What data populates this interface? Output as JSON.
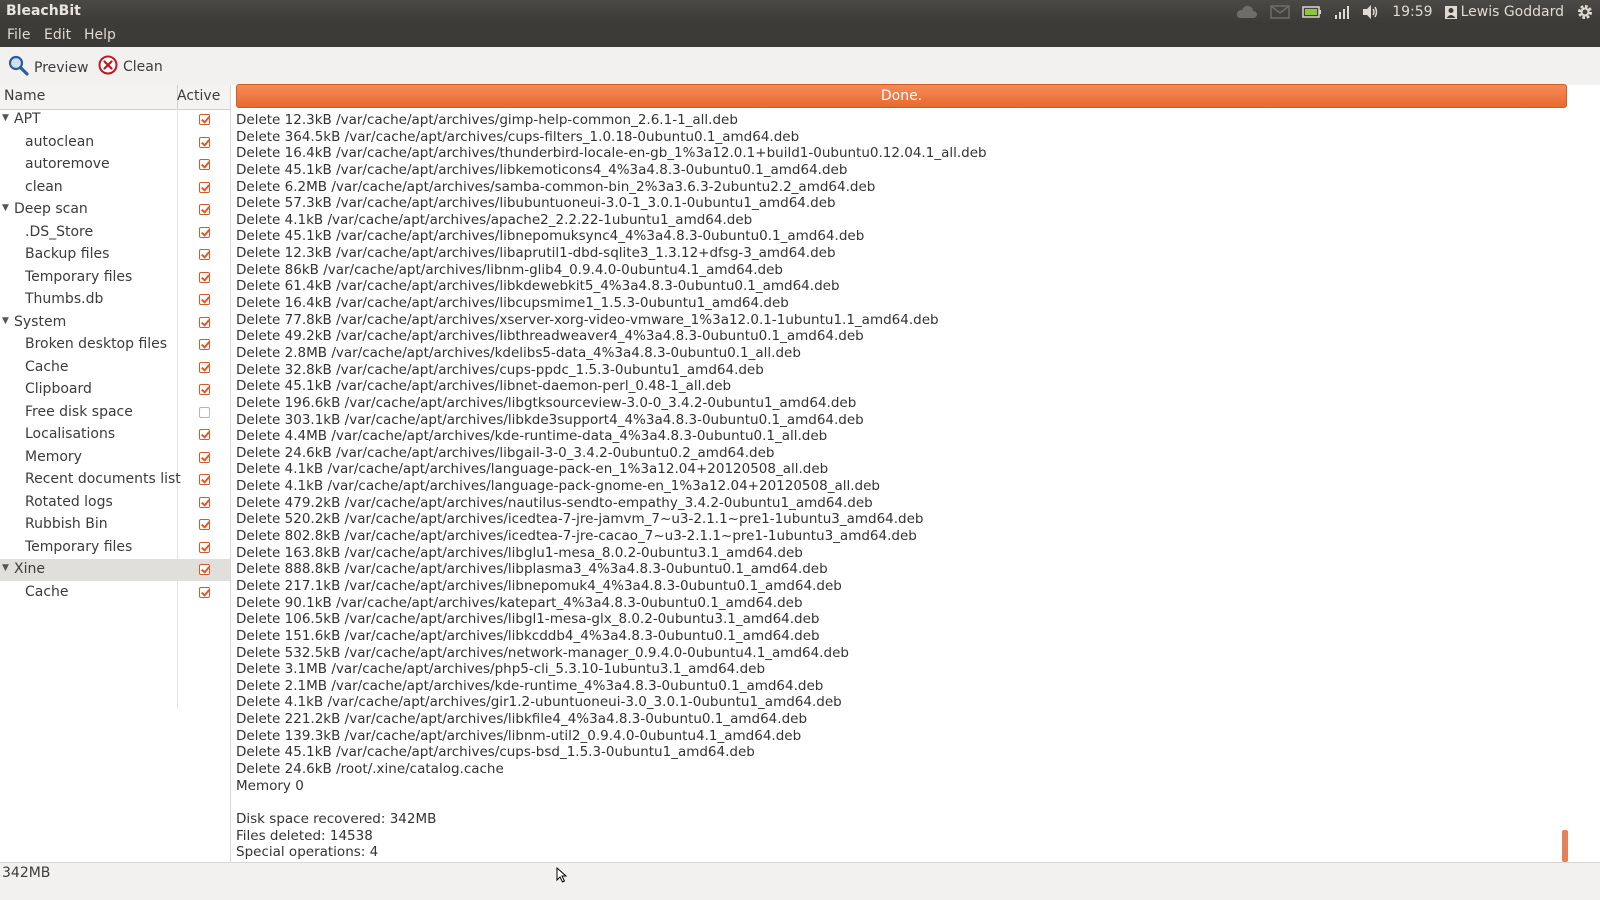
{
  "window": {
    "title": "BleachBit"
  },
  "panel": {
    "time": "19:59",
    "user": "Lewis Goddard",
    "icons": [
      "cloud-icon",
      "mail-icon",
      "battery-icon",
      "network-icon",
      "volume-icon",
      "user-icon",
      "gear-icon"
    ]
  },
  "menu": {
    "file": "File",
    "edit": "Edit",
    "help": "Help"
  },
  "toolbar": {
    "preview_label": "Preview",
    "clean_label": "Clean"
  },
  "tree": {
    "header_name": "Name",
    "header_active": "Active",
    "rows": [
      {
        "label": "APT",
        "level": 0,
        "checked": true
      },
      {
        "label": "autoclean",
        "level": 1,
        "checked": true
      },
      {
        "label": "autoremove",
        "level": 1,
        "checked": true
      },
      {
        "label": "clean",
        "level": 1,
        "checked": true
      },
      {
        "label": "Deep scan",
        "level": 0,
        "checked": true
      },
      {
        "label": ".DS_Store",
        "level": 1,
        "checked": true
      },
      {
        "label": "Backup files",
        "level": 1,
        "checked": true
      },
      {
        "label": "Temporary files",
        "level": 1,
        "checked": true
      },
      {
        "label": "Thumbs.db",
        "level": 1,
        "checked": true
      },
      {
        "label": "System",
        "level": 0,
        "checked": true
      },
      {
        "label": "Broken desktop files",
        "level": 1,
        "checked": true
      },
      {
        "label": "Cache",
        "level": 1,
        "checked": true
      },
      {
        "label": "Clipboard",
        "level": 1,
        "checked": true
      },
      {
        "label": "Free disk space",
        "level": 1,
        "checked": false
      },
      {
        "label": "Localisations",
        "level": 1,
        "checked": true
      },
      {
        "label": "Memory",
        "level": 1,
        "checked": true
      },
      {
        "label": "Recent documents list",
        "level": 1,
        "checked": true
      },
      {
        "label": "Rotated logs",
        "level": 1,
        "checked": true
      },
      {
        "label": "Rubbish Bin",
        "level": 1,
        "checked": true
      },
      {
        "label": "Temporary files",
        "level": 1,
        "checked": true
      },
      {
        "label": "Xine",
        "level": 0,
        "checked": true,
        "selected": true
      },
      {
        "label": "Cache",
        "level": 1,
        "checked": true
      }
    ]
  },
  "progress": {
    "text": "Done."
  },
  "log": {
    "lines": [
      "Delete 12.3kB /var/cache/apt/archives/gimp-help-common_2.6.1-1_all.deb",
      "Delete 364.5kB /var/cache/apt/archives/cups-filters_1.0.18-0ubuntu0.1_amd64.deb",
      "Delete 16.4kB /var/cache/apt/archives/thunderbird-locale-en-gb_1%3a12.0.1+build1-0ubuntu0.12.04.1_all.deb",
      "Delete 45.1kB /var/cache/apt/archives/libkemoticons4_4%3a4.8.3-0ubuntu0.1_amd64.deb",
      "Delete 6.2MB /var/cache/apt/archives/samba-common-bin_2%3a3.6.3-2ubuntu2.2_amd64.deb",
      "Delete 57.3kB /var/cache/apt/archives/libubuntuoneui-3.0-1_3.0.1-0ubuntu1_amd64.deb",
      "Delete 4.1kB /var/cache/apt/archives/apache2_2.2.22-1ubuntu1_amd64.deb",
      "Delete 45.1kB /var/cache/apt/archives/libnepomuksync4_4%3a4.8.3-0ubuntu0.1_amd64.deb",
      "Delete 12.3kB /var/cache/apt/archives/libaprutil1-dbd-sqlite3_1.3.12+dfsg-3_amd64.deb",
      "Delete 86kB /var/cache/apt/archives/libnm-glib4_0.9.4.0-0ubuntu4.1_amd64.deb",
      "Delete 61.4kB /var/cache/apt/archives/libkdewebkit5_4%3a4.8.3-0ubuntu0.1_amd64.deb",
      "Delete 16.4kB /var/cache/apt/archives/libcupsmime1_1.5.3-0ubuntu1_amd64.deb",
      "Delete 77.8kB /var/cache/apt/archives/xserver-xorg-video-vmware_1%3a12.0.1-1ubuntu1.1_amd64.deb",
      "Delete 49.2kB /var/cache/apt/archives/libthreadweaver4_4%3a4.8.3-0ubuntu0.1_amd64.deb",
      "Delete 2.8MB /var/cache/apt/archives/kdelibs5-data_4%3a4.8.3-0ubuntu0.1_all.deb",
      "Delete 32.8kB /var/cache/apt/archives/cups-ppdc_1.5.3-0ubuntu1_amd64.deb",
      "Delete 45.1kB /var/cache/apt/archives/libnet-daemon-perl_0.48-1_all.deb",
      "Delete 196.6kB /var/cache/apt/archives/libgtksourceview-3.0-0_3.4.2-0ubuntu1_amd64.deb",
      "Delete 303.1kB /var/cache/apt/archives/libkde3support4_4%3a4.8.3-0ubuntu0.1_amd64.deb",
      "Delete 4.4MB /var/cache/apt/archives/kde-runtime-data_4%3a4.8.3-0ubuntu0.1_all.deb",
      "Delete 24.6kB /var/cache/apt/archives/libgail-3-0_3.4.2-0ubuntu0.2_amd64.deb",
      "Delete 4.1kB /var/cache/apt/archives/language-pack-en_1%3a12.04+20120508_all.deb",
      "Delete 4.1kB /var/cache/apt/archives/language-pack-gnome-en_1%3a12.04+20120508_all.deb",
      "Delete 479.2kB /var/cache/apt/archives/nautilus-sendto-empathy_3.4.2-0ubuntu1_amd64.deb",
      "Delete 520.2kB /var/cache/apt/archives/icedtea-7-jre-jamvm_7~u3-2.1.1~pre1-1ubuntu3_amd64.deb",
      "Delete 802.8kB /var/cache/apt/archives/icedtea-7-jre-cacao_7~u3-2.1.1~pre1-1ubuntu3_amd64.deb",
      "Delete 163.8kB /var/cache/apt/archives/libglu1-mesa_8.0.2-0ubuntu3.1_amd64.deb",
      "Delete 888.8kB /var/cache/apt/archives/libplasma3_4%3a4.8.3-0ubuntu0.1_amd64.deb",
      "Delete 217.1kB /var/cache/apt/archives/libnepomuk4_4%3a4.8.3-0ubuntu0.1_amd64.deb",
      "Delete 90.1kB /var/cache/apt/archives/katepart_4%3a4.8.3-0ubuntu0.1_amd64.deb",
      "Delete 106.5kB /var/cache/apt/archives/libgl1-mesa-glx_8.0.2-0ubuntu3.1_amd64.deb",
      "Delete 151.6kB /var/cache/apt/archives/libkcddb4_4%3a4.8.3-0ubuntu0.1_amd64.deb",
      "Delete 532.5kB /var/cache/apt/archives/network-manager_0.9.4.0-0ubuntu4.1_amd64.deb",
      "Delete 3.1MB /var/cache/apt/archives/php5-cli_5.3.10-1ubuntu3.1_amd64.deb",
      "Delete 2.1MB /var/cache/apt/archives/kde-runtime_4%3a4.8.3-0ubuntu0.1_amd64.deb",
      "Delete 4.1kB /var/cache/apt/archives/gir1.2-ubuntuoneui-3.0_3.0.1-0ubuntu1_amd64.deb",
      "Delete 221.2kB /var/cache/apt/archives/libkfile4_4%3a4.8.3-0ubuntu0.1_amd64.deb",
      "Delete 139.3kB /var/cache/apt/archives/libnm-util2_0.9.4.0-0ubuntu4.1_amd64.deb",
      "Delete 45.1kB /var/cache/apt/archives/cups-bsd_1.5.3-0ubuntu1_amd64.deb",
      "Delete 24.6kB /root/.xine/catalog.cache",
      "Memory 0",
      "",
      "Disk space recovered: 342MB",
      "Files deleted: 14538",
      "Special operations: 4"
    ]
  },
  "status": {
    "text": "342MB"
  }
}
